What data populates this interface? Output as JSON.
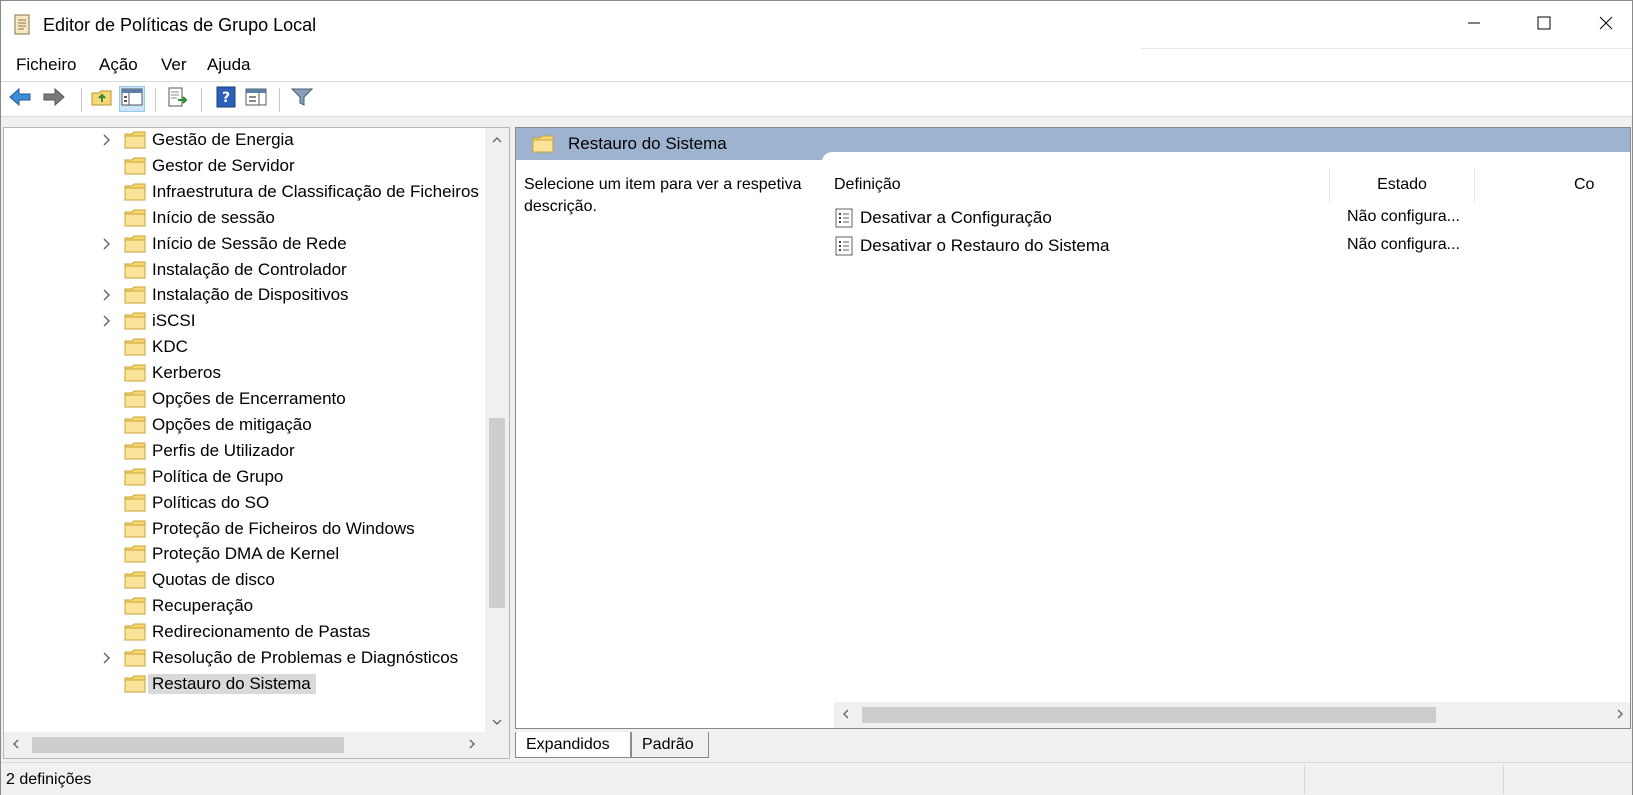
{
  "window": {
    "title": "Editor de Políticas de Grupo Local"
  },
  "menu": {
    "items": [
      "Ficheiro",
      "Ação",
      "Ver",
      "Ajuda"
    ]
  },
  "toolbar": {
    "buttons": [
      "back-icon",
      "forward-icon",
      "up-folder-icon",
      "show-hide-tree-icon",
      "export-list-icon",
      "help-icon",
      "properties-icon",
      "filter-icon"
    ]
  },
  "tree": {
    "items": [
      {
        "label": "Gestão de Energia",
        "expandable": true
      },
      {
        "label": "Gestor de Servidor",
        "expandable": false
      },
      {
        "label": "Infraestrutura de Classificação de Ficheiros",
        "expandable": false
      },
      {
        "label": "Início de sessão",
        "expandable": false
      },
      {
        "label": "Início de Sessão de Rede",
        "expandable": true
      },
      {
        "label": "Instalação de Controlador",
        "expandable": false
      },
      {
        "label": "Instalação de Dispositivos",
        "expandable": true
      },
      {
        "label": "iSCSI",
        "expandable": true
      },
      {
        "label": "KDC",
        "expandable": false
      },
      {
        "label": "Kerberos",
        "expandable": false
      },
      {
        "label": "Opções de Encerramento",
        "expandable": false
      },
      {
        "label": "Opções de mitigação",
        "expandable": false
      },
      {
        "label": "Perfis de Utilizador",
        "expandable": false
      },
      {
        "label": "Política de Grupo",
        "expandable": false
      },
      {
        "label": "Políticas do SO",
        "expandable": false
      },
      {
        "label": "Proteção de Ficheiros do Windows",
        "expandable": false
      },
      {
        "label": "Proteção DMA de Kernel",
        "expandable": false
      },
      {
        "label": "Quotas de disco",
        "expandable": false
      },
      {
        "label": "Recuperação",
        "expandable": false
      },
      {
        "label": "Redirecionamento de Pastas",
        "expandable": false
      },
      {
        "label": "Resolução de Problemas e Diagnósticos",
        "expandable": true
      },
      {
        "label": "Restauro do Sistema",
        "expandable": false,
        "selected": true
      }
    ]
  },
  "details": {
    "title": "Restauro do Sistema",
    "description": "Selecione um item para ver a respetiva descrição.",
    "columns": {
      "definition": "Definição",
      "state": "Estado",
      "comment": "Co"
    },
    "rows": [
      {
        "name": "Desativar a Configuração",
        "state": "Não configura..."
      },
      {
        "name": "Desativar o Restauro do Sistema",
        "state": "Não configura..."
      }
    ]
  },
  "tabs": {
    "expanded": "Expandidos",
    "standard": "Padrão"
  },
  "status": {
    "text": "2 definições"
  },
  "colors": {
    "banner": "#9db3cf",
    "folder": "#f7d774",
    "selection": "#d9d9d9"
  }
}
